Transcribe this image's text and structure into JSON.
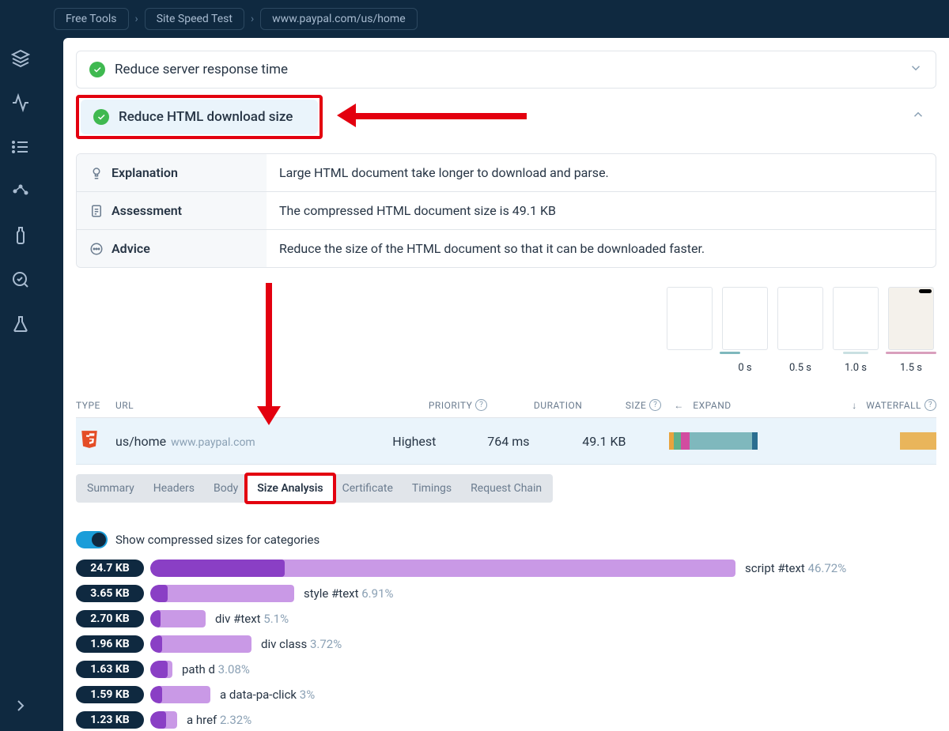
{
  "breadcrumb": [
    "Free Tools",
    "Site Speed Test",
    "www.paypal.com/us/home"
  ],
  "accordion": {
    "row1": "Reduce server response time",
    "row2": "Reduce HTML download size"
  },
  "info": {
    "explanation_label": "Explanation",
    "explanation_text": "Large HTML document take longer to download and parse.",
    "assessment_label": "Assessment",
    "assessment_text": "The compressed HTML document size is 49.1 KB",
    "advice_label": "Advice",
    "advice_text": "Reduce the size of the HTML document so that it can be downloaded faster."
  },
  "thumb_times": [
    "0 s",
    "0.5 s",
    "1.0 s",
    "1.5 s"
  ],
  "req_header": {
    "type": "TYPE",
    "url": "URL",
    "priority": "PRIORITY",
    "duration": "DURATION",
    "size": "SIZE",
    "expand": "EXPAND",
    "waterfall": "WATERFALL"
  },
  "request": {
    "path": "us/home",
    "domain": "www.paypal.com",
    "priority": "Highest",
    "duration": "764 ms",
    "size": "49.1 KB"
  },
  "waterfall1": [
    {
      "w": 4,
      "c": "#e8a33d"
    },
    {
      "w": 6,
      "c": "#5fb08c"
    },
    {
      "w": 8,
      "c": "#d24ca0"
    },
    {
      "w": 54,
      "c": "#7fb8bd"
    },
    {
      "w": 5,
      "c": "#2b6e90"
    }
  ],
  "waterfall2": [
    {
      "w": 80,
      "c": "transparent"
    },
    {
      "w": 20,
      "c": "#e9b55b"
    }
  ],
  "subtabs": [
    "Summary",
    "Headers",
    "Body",
    "Size Analysis",
    "Certificate",
    "Timings",
    "Request Chain"
  ],
  "active_subtab": 3,
  "toggle_label": "Show compressed sizes for categories",
  "size_rows": [
    {
      "size": "24.7 KB",
      "outer": 740,
      "innerPct": 23,
      "label": "script #text",
      "pct": "46.72%"
    },
    {
      "size": "3.65 KB",
      "outer": 182,
      "innerPct": 12,
      "label": "style #text",
      "pct": "6.91%"
    },
    {
      "size": "2.70 KB",
      "outer": 70,
      "innerPct": 18,
      "label": "div #text",
      "pct": "5.1%"
    },
    {
      "size": "1.96 KB",
      "outer": 128,
      "innerPct": 12,
      "label": "div class",
      "pct": "3.72%"
    },
    {
      "size": "1.63 KB",
      "outer": 28,
      "innerPct": 80,
      "label": "path d",
      "pct": "3.08%"
    },
    {
      "size": "1.59 KB",
      "outer": 76,
      "innerPct": 20,
      "label": "a data-pa-click",
      "pct": "3%"
    },
    {
      "size": "1.23 KB",
      "outer": 34,
      "innerPct": 60,
      "label": "a href",
      "pct": "2.32%"
    }
  ],
  "arrows": {
    "left": "←",
    "down": "↓"
  }
}
